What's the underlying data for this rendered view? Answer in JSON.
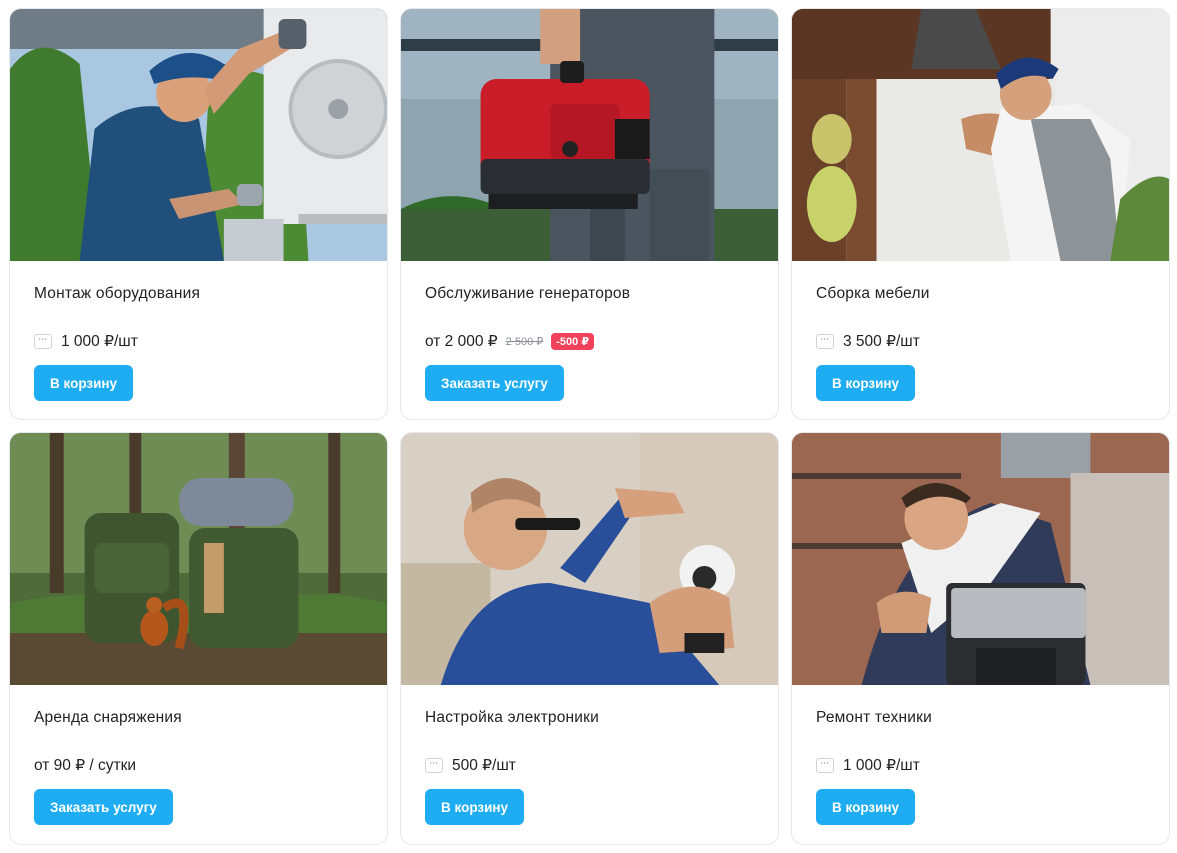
{
  "accent_color": "#1eacf2",
  "discount_color": "#f2415a",
  "cards": [
    {
      "title": "Монтаж оборудования",
      "price": "1 000 ₽/шт",
      "qty_icon": "⋯",
      "button": "В корзину",
      "image": "ac-installer-photo"
    },
    {
      "title": "Обслуживание генераторов",
      "price": "от 2 000 ₽",
      "old_price": "2 500 ₽",
      "discount": "-500 ₽",
      "button": "Заказать услугу",
      "image": "generator-photo"
    },
    {
      "title": "Сборка мебели",
      "price": "3 500 ₽/шт",
      "qty_icon": "⋯",
      "button": "В корзину",
      "image": "furniture-assembly-photo"
    },
    {
      "title": "Аренда снаряжения",
      "price": "от 90 ₽ / сутки",
      "button": "Заказать услугу",
      "image": "backpacks-forest-photo"
    },
    {
      "title": "Настройка электроники",
      "price": "500 ₽/шт",
      "qty_icon": "⋯",
      "button": "В корзину",
      "image": "camera-install-photo"
    },
    {
      "title": "Ремонт техники",
      "price": "1 000 ₽/шт",
      "qty_icon": "⋯",
      "button": "В корзину",
      "image": "coffee-machine-repair-photo"
    }
  ]
}
